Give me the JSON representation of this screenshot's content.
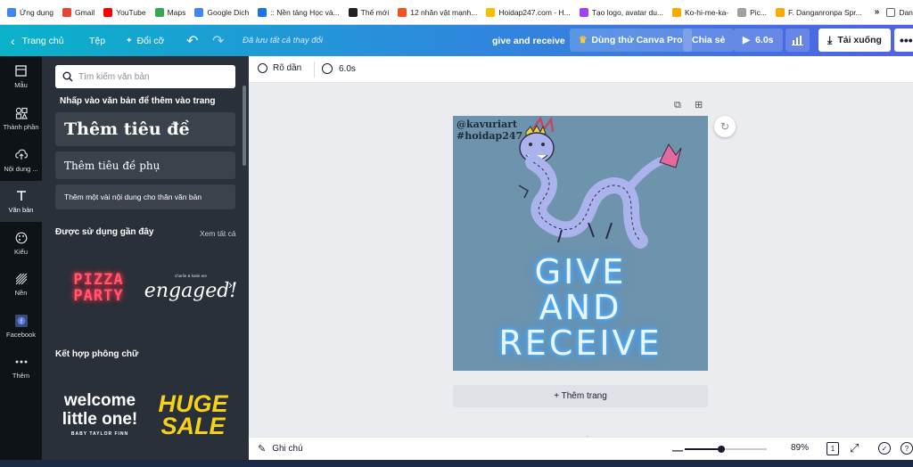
{
  "bookmarks": [
    {
      "label": "Ứng dụng",
      "color": "#4285f4"
    },
    {
      "label": "Gmail",
      "color": "#ea4335"
    },
    {
      "label": "YouTube",
      "color": "#ff0000"
    },
    {
      "label": "Maps",
      "color": "#34a853"
    },
    {
      "label": "Google Dich",
      "color": "#4285f4"
    },
    {
      "label": ":: Nền tảng Học và...",
      "color": "#1a73e8"
    },
    {
      "label": "Thế mới",
      "color": "#202124"
    },
    {
      "label": "12 nhân vật mạnh...",
      "color": "#f4511e"
    },
    {
      "label": "Hoidap247.com - H...",
      "color": "#fbbc04"
    },
    {
      "label": "Tạo logo, avatar du...",
      "color": "#a142f4"
    },
    {
      "label": "Ko-hi-me-ka-",
      "color": "#f9ab00"
    },
    {
      "label": "Pic...",
      "color": "#9aa0a6"
    },
    {
      "label": "F. Danganronpa Spr...",
      "color": "#f9ab00"
    }
  ],
  "bookmarks_more": "»",
  "bookmarks_reading_list": "Danh sách đọc",
  "toolbar": {
    "home": "Trang chủ",
    "file": "Tệp",
    "resize": "Đổi cỡ",
    "saved_status": "Đã lưu tất cả thay đổi",
    "design_title": "give and receive",
    "try_pro": "Dùng thử Canva Pro",
    "share": "Chia sẻ",
    "play_duration": "6.0s",
    "download": "Tải xuống"
  },
  "rail": [
    {
      "label": "Mẫu",
      "icon": "template-icon",
      "active": false
    },
    {
      "label": "Thành phần",
      "icon": "elements-icon",
      "active": false
    },
    {
      "label": "Nội dung ...",
      "icon": "uploads-icon",
      "active": false
    },
    {
      "label": "Văn bản",
      "icon": "text-icon",
      "active": true
    },
    {
      "label": "Kiểu",
      "icon": "styles-icon",
      "active": false
    },
    {
      "label": "Nền",
      "icon": "background-icon",
      "active": false
    },
    {
      "label": "Facebook",
      "icon": "facebook-icon",
      "active": false
    },
    {
      "label": "Thêm",
      "icon": "more-icon",
      "active": false
    }
  ],
  "panel": {
    "search_placeholder": "Tìm kiếm văn bản",
    "instruction": "Nhấp vào văn bản để thêm vào trang",
    "heading_button": "Thêm tiêu đề",
    "subheading_button": "Thêm tiêu đề phụ",
    "body_button": "Thêm một vài nội dung cho thân văn bản",
    "recent_title": "Được sử dụng gần đây",
    "see_all": "Xem tất cả",
    "recent_items": [
      {
        "line1": "PIZZA",
        "line2": "PARTY"
      },
      {
        "small": "charlie & katie are",
        "script": "engaged!"
      }
    ],
    "combos_title": "Kết hợp phông chữ",
    "combo_items": [
      {
        "line1": "welcome",
        "line2": "little one!",
        "small": "BABY TAYLOR FINN"
      },
      {
        "line1": "HUGE",
        "line2": "SALE"
      }
    ]
  },
  "subbar": {
    "animate": "Rõ dần",
    "duration": "6.0s"
  },
  "design": {
    "watermark_1": "@kavuriart",
    "watermark_2": "hoidap247",
    "line1": "GIVE",
    "line2": "AND",
    "line3": "RECEIVE",
    "bg_color": "#6e93ac",
    "text_glow_color": "#4fb4ff"
  },
  "add_page": "+ Thêm trang",
  "bottom": {
    "notes": "Ghi chú",
    "zoom": "89%",
    "page_number": "1",
    "zoom_level": 0.45
  }
}
